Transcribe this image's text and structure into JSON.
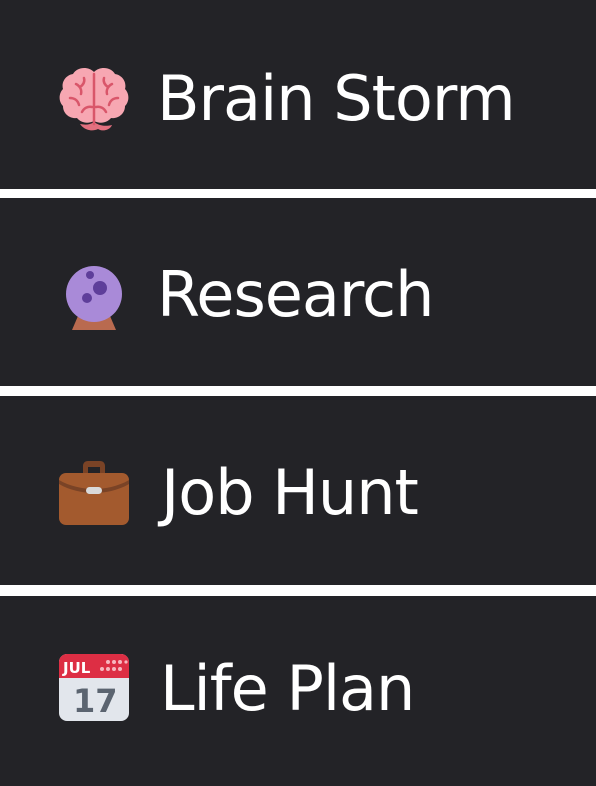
{
  "menu": {
    "items": [
      {
        "label": "Brain Storm",
        "icon": "brain-icon"
      },
      {
        "label": "Research",
        "icon": "crystal-ball-icon"
      },
      {
        "label": "Job Hunt",
        "icon": "briefcase-icon"
      },
      {
        "label": "Life Plan",
        "icon": "calendar-icon"
      }
    ],
    "calendar_month": "JUL",
    "calendar_day": "17"
  },
  "colors": {
    "background": "#232327",
    "text": "#ffffff",
    "divider": "#ffffff"
  }
}
